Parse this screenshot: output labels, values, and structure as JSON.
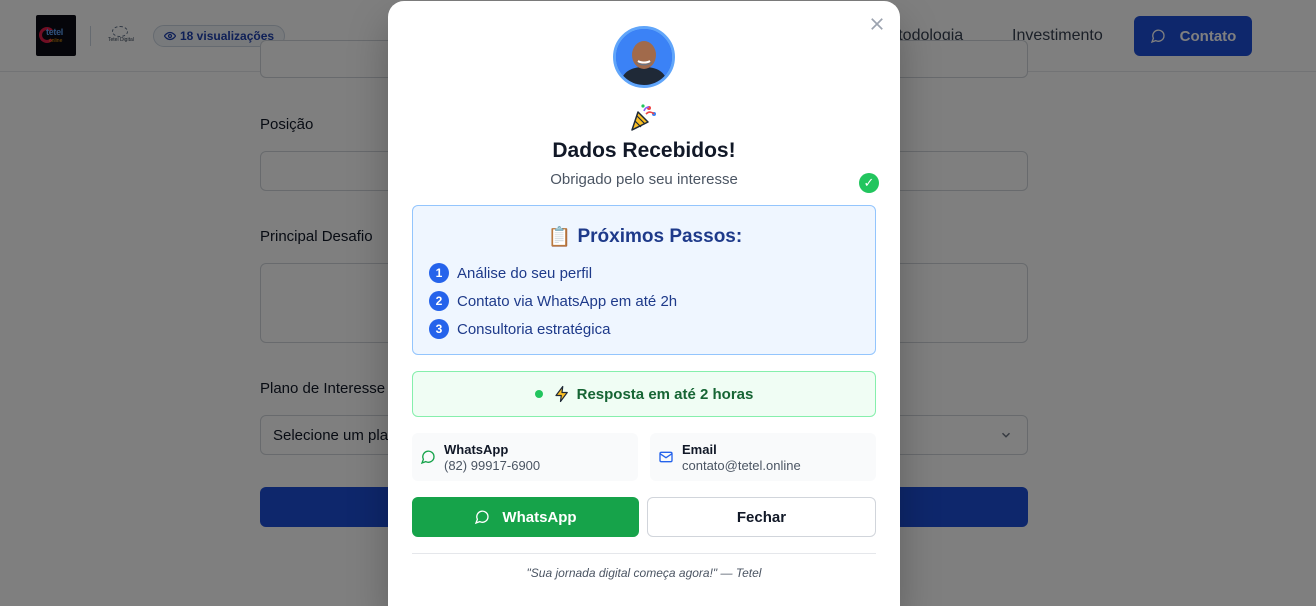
{
  "header": {
    "logo_text": "tetel",
    "logo_sub": "online",
    "partner_logo_text": "Tetel Digital",
    "views_label": "18 visualizações",
    "nav": [
      "Metodologia",
      "Investimento"
    ],
    "contact_button": "Contato"
  },
  "form": {
    "position_label": "Posição",
    "challenge_label": "Principal Desafio",
    "plan_label": "Plano de Interesse",
    "plan_select_value": "Selecione um plano"
  },
  "modal": {
    "title": "Dados Recebidos!",
    "subtitle": "Obrigado pelo seu interesse",
    "steps_emoji": "📋",
    "steps_title": "Próximos Passos:",
    "steps": [
      {
        "num": "1",
        "text": "Análise do seu perfil"
      },
      {
        "num": "2",
        "text": "Contato via WhatsApp em até 2h"
      },
      {
        "num": "3",
        "text": "Consultoria estratégica"
      }
    ],
    "response_text": "Resposta em até 2 horas",
    "whatsapp_card": {
      "label": "WhatsApp",
      "value": "(82) 99917-6900"
    },
    "email_card": {
      "label": "Email",
      "value": "contato@tetel.online"
    },
    "whatsapp_button": "WhatsApp",
    "close_button": "Fechar",
    "quote": "\"Sua jornada digital começa agora!\" — Tetel"
  },
  "colors": {
    "primary": "#1d4ed8",
    "success": "#16a34a",
    "overlay": "rgba(0,0,0,0.5)"
  },
  "icons": [
    "eye-icon",
    "chat-icon",
    "chevron-down-icon",
    "close-icon",
    "party-popper-icon",
    "check-icon",
    "lightning-icon",
    "mail-icon"
  ]
}
